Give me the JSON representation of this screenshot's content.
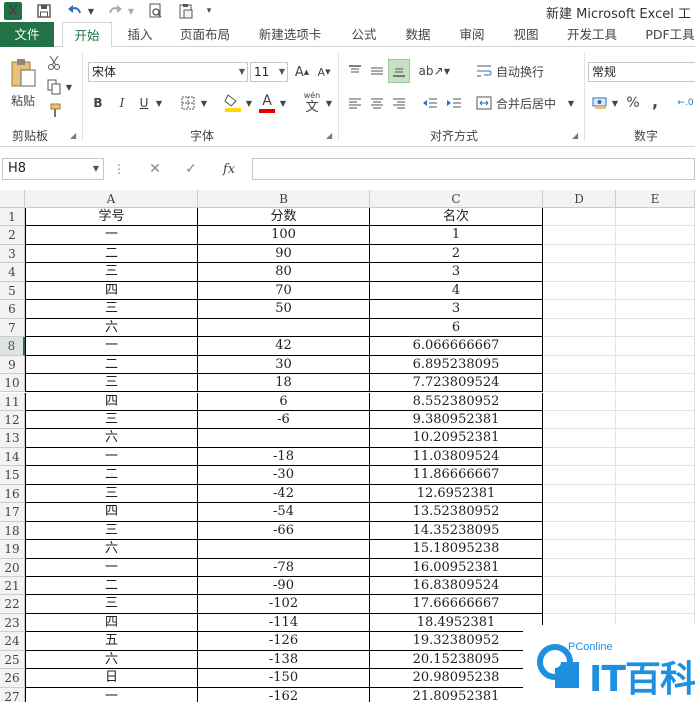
{
  "app": {
    "title": "新建 Microsoft Excel 工",
    "icon": "excel-icon",
    "accent": "#217346"
  },
  "quick_access": [
    "save-icon",
    "undo-icon",
    "redo-icon",
    "print-preview-icon",
    "paste-special-icon",
    "customize-dropdown-icon"
  ],
  "tabs": [
    {
      "label": "文件",
      "kind": "file"
    },
    {
      "label": "开始",
      "kind": "active"
    },
    {
      "label": "插入"
    },
    {
      "label": "页面布局"
    },
    {
      "label": "新建选项卡"
    },
    {
      "label": "公式"
    },
    {
      "label": "数据"
    },
    {
      "label": "审阅"
    },
    {
      "label": "视图"
    },
    {
      "label": "开发工具"
    },
    {
      "label": "PDF工具"
    }
  ],
  "ribbon": {
    "clipboard": {
      "label": "剪贴板",
      "paste": "粘贴"
    },
    "font": {
      "label": "字体",
      "family": "宋体",
      "size": "11",
      "bold": "B",
      "italic": "I",
      "underline": "U",
      "wen": "wén",
      "wen_char": "文"
    },
    "alignment": {
      "label": "对齐方式",
      "wrap": "自动换行",
      "merge": "合并后居中"
    },
    "number": {
      "label": "数字",
      "format": "常规",
      "percent": "%",
      "comma": ","
    }
  },
  "formula_bar": {
    "name_box": "H8",
    "cancel": "✕",
    "enter": "✓",
    "fx": "fx",
    "content": ""
  },
  "sheet": {
    "columns": [
      "A",
      "B",
      "C",
      "D",
      "E"
    ],
    "selected_row": 8,
    "rows": [
      {
        "n": 1,
        "a": "学号",
        "b": "分数",
        "c": "名次"
      },
      {
        "n": 2,
        "a": "一",
        "b": "100",
        "c": "1"
      },
      {
        "n": 3,
        "a": "二",
        "b": "90",
        "c": "2"
      },
      {
        "n": 4,
        "a": "三",
        "b": "80",
        "c": "3"
      },
      {
        "n": 5,
        "a": "四",
        "b": "70",
        "c": "4"
      },
      {
        "n": 6,
        "a": "三",
        "b": "50",
        "c": "3"
      },
      {
        "n": 7,
        "a": "六",
        "b": "",
        "c": "6"
      },
      {
        "n": 8,
        "a": "一",
        "b": "42",
        "c": "6.066666667"
      },
      {
        "n": 9,
        "a": "二",
        "b": "30",
        "c": "6.895238095"
      },
      {
        "n": 10,
        "a": "三",
        "b": "18",
        "c": "7.723809524"
      },
      {
        "n": 11,
        "a": "四",
        "b": "6",
        "c": "8.552380952"
      },
      {
        "n": 12,
        "a": "三",
        "b": "-6",
        "c": "9.380952381"
      },
      {
        "n": 13,
        "a": "六",
        "b": "",
        "c": "10.20952381"
      },
      {
        "n": 14,
        "a": "一",
        "b": "-18",
        "c": "11.03809524"
      },
      {
        "n": 15,
        "a": "二",
        "b": "-30",
        "c": "11.86666667"
      },
      {
        "n": 16,
        "a": "三",
        "b": "-42",
        "c": "12.6952381"
      },
      {
        "n": 17,
        "a": "四",
        "b": "-54",
        "c": "13.52380952"
      },
      {
        "n": 18,
        "a": "三",
        "b": "-66",
        "c": "14.35238095"
      },
      {
        "n": 19,
        "a": "六",
        "b": "",
        "c": "15.18095238"
      },
      {
        "n": 20,
        "a": "一",
        "b": "-78",
        "c": "16.00952381"
      },
      {
        "n": 21,
        "a": "二",
        "b": "-90",
        "c": "16.83809524"
      },
      {
        "n": 22,
        "a": "三",
        "b": "-102",
        "c": "17.66666667"
      },
      {
        "n": 23,
        "a": "四",
        "b": "-114",
        "c": "18.4952381"
      },
      {
        "n": 24,
        "a": "五",
        "b": "-126",
        "c": "19.32380952"
      },
      {
        "n": 25,
        "a": "六",
        "b": "-138",
        "c": "20.15238095"
      },
      {
        "n": 26,
        "a": "日",
        "b": "-150",
        "c": "20.98095238"
      },
      {
        "n": 27,
        "a": "一",
        "b": "-162",
        "c": "21.80952381"
      }
    ]
  },
  "watermark": {
    "brand": "PConline",
    "word": "IT百科",
    "color": "#1f8fe0"
  }
}
